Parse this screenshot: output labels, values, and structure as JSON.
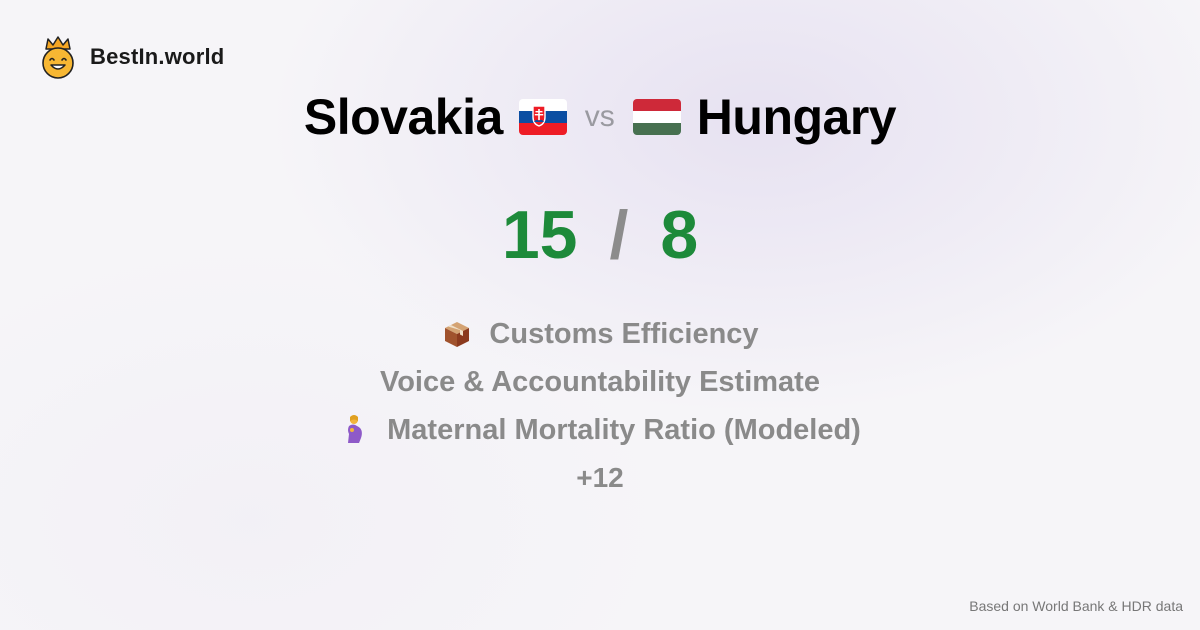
{
  "brand": {
    "name": "BestIn.world",
    "logo_icon": "crown-smiley-icon"
  },
  "comparison": {
    "left_country": "Slovakia",
    "left_flag_icon": "slovakia-flag-icon",
    "vs_label": "vs",
    "right_country": "Hungary",
    "right_flag_icon": "hungary-flag-icon"
  },
  "score": {
    "left": "15",
    "separator": "/",
    "right": "8",
    "color": "#1d8a3a"
  },
  "metrics": [
    {
      "label": "Customs Efficiency",
      "icon": "package-icon"
    },
    {
      "label": "Voice & Accountability Estimate",
      "icon": ""
    },
    {
      "label": "Maternal Mortality Ratio (Modeled)",
      "icon": "pregnant-woman-icon"
    }
  ],
  "more_label": "+12",
  "footer": {
    "source": "Based on World Bank & HDR data"
  },
  "colors": {
    "slovakia": [
      "#ffffff",
      "#0b4ea2",
      "#ee1c25"
    ],
    "hungary": [
      "#ce2939",
      "#ffffff",
      "#477050"
    ]
  }
}
